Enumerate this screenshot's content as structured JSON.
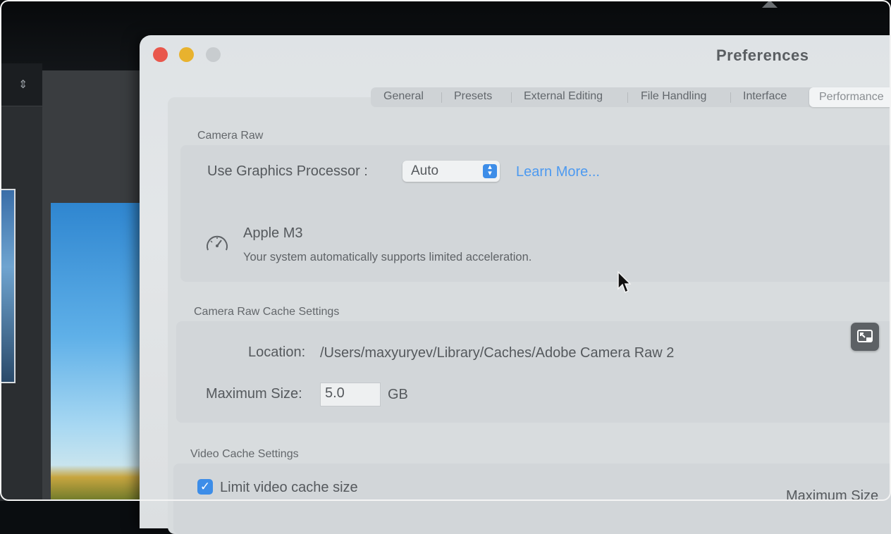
{
  "window": {
    "title": "Preferences"
  },
  "tabs": [
    {
      "label": "General"
    },
    {
      "label": "Presets"
    },
    {
      "label": "External Editing"
    },
    {
      "label": "File Handling"
    },
    {
      "label": "Interface"
    },
    {
      "label": "Performance",
      "active": true
    }
  ],
  "camera_raw": {
    "section_label": "Camera Raw",
    "gpu_label": "Use Graphics Processor :",
    "gpu_value": "Auto",
    "learn_more": "Learn More...",
    "gpu_name": "Apple M3",
    "gpu_description": "Your system automatically supports limited acceleration."
  },
  "cache": {
    "section_label": "Camera Raw Cache Settings",
    "location_label": "Location:",
    "location_value": "/Users/maxyuryev/Library/Caches/Adobe Camera Raw 2",
    "max_size_label": "Maximum Size:",
    "max_size_value": "5.0",
    "max_size_unit": "GB"
  },
  "video_cache": {
    "section_label": "Video Cache Settings",
    "limit_label": "Limit video cache size",
    "limit_checked": true,
    "max_size_label": "Maximum Size"
  },
  "colors": {
    "accent": "#3d8de8",
    "close": "#e9574c",
    "minimize": "#e8b22e",
    "link": "#4d9af0"
  }
}
